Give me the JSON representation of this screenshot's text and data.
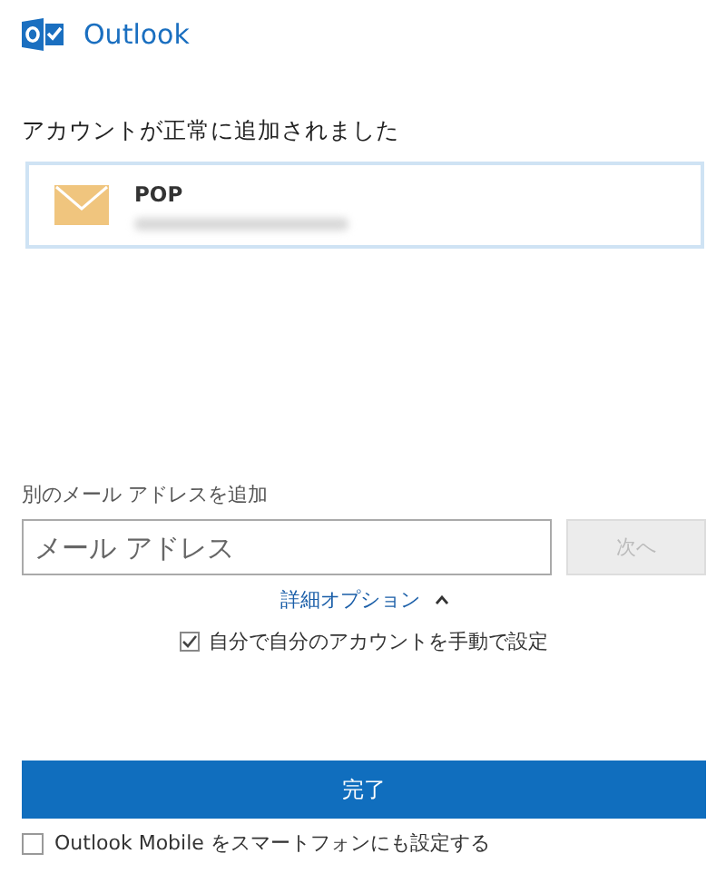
{
  "app": {
    "title": "Outlook"
  },
  "status_message": "アカウントが正常に追加されました",
  "account": {
    "type": "POP"
  },
  "add_account": {
    "label": "別のメール アドレスを追加",
    "email_field": {
      "placeholder": "メール アドレス"
    },
    "next_button": {
      "label": "次へ",
      "disabled": true
    }
  },
  "advanced_options": {
    "label": "詳細オプション",
    "expanded": true
  },
  "manual_setup": {
    "label": "自分で自分のアカウントを手動で設定",
    "checked": true
  },
  "done_button": {
    "label": "完了"
  },
  "mobile_setup": {
    "label": "Outlook Mobile をスマートフォンにも設定する",
    "checked": false
  }
}
